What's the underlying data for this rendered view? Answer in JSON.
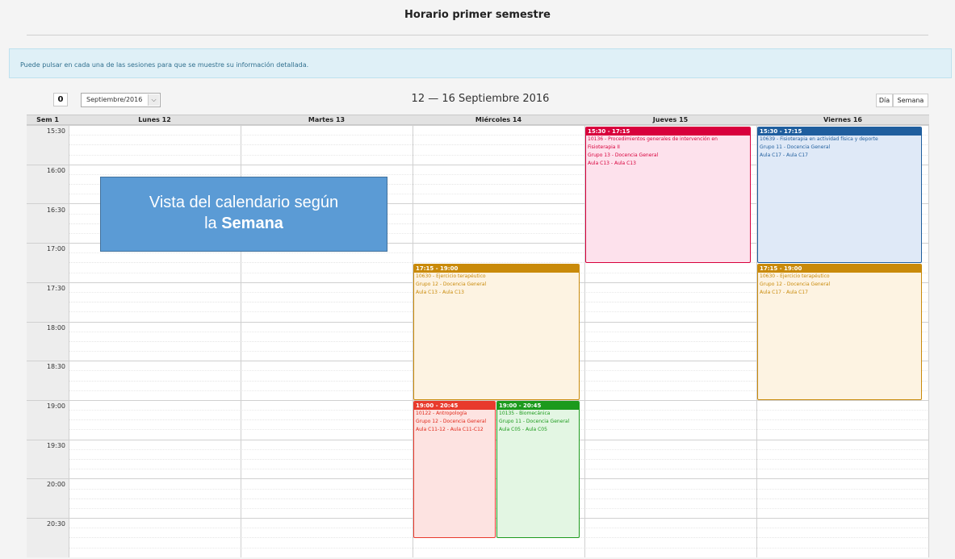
{
  "page": {
    "title": "Horario primer semestre",
    "info": "Puede pulsar en cada una de las sesiones para que se muestre su información detallada."
  },
  "toolbar": {
    "today_label": "0",
    "month_select": "Septiembre/2016",
    "date_range": "12 — 16 Septiembre 2016",
    "view_day": "Día",
    "view_week": "Semana"
  },
  "calendar": {
    "week_label": "Sem 1",
    "days": [
      {
        "label": "Lunes 12"
      },
      {
        "label": "Martes 13"
      },
      {
        "label": "Miércoles 14"
      },
      {
        "label": "Jueves 15"
      },
      {
        "label": "Viernes 16"
      }
    ],
    "time_labels": [
      "15:30",
      "16:00",
      "16:30",
      "17:00",
      "17:30",
      "18:00",
      "18:30",
      "19:00",
      "19:30",
      "20:00",
      "20:30"
    ],
    "events": [
      {
        "time": "15:30 - 17:15",
        "line1": "10136 - Procedimientos generales de intervención en",
        "line2": "Fisioterapia II",
        "line3": "Grupo 13 - Docencia General",
        "line4": "Aula C13 - Aula C13",
        "head_color": "#d8003c",
        "bg_color": "#fde1ec",
        "text_color": "#d8003c"
      },
      {
        "time": "15:30 - 17:15",
        "line1": "10639 - Fisioterapia en actividad física y deporte",
        "line2": "Grupo 11 - Docencia General",
        "line3": "Aula C17 - Aula C17",
        "head_color": "#1f5e9e",
        "bg_color": "#dfe9f7",
        "text_color": "#1f5e9e"
      },
      {
        "time": "17:15 - 19:00",
        "line1": "10630 - Ejercicio terapéutico",
        "line2": "Grupo 12 - Docencia General",
        "line3": "Aula C13 - Aula C13",
        "head_color": "#c98a0a",
        "bg_color": "#fdf3e2",
        "text_color": "#c98a0a"
      },
      {
        "time": "17:15 - 19:00",
        "line1": "10630 - Ejercicio terapéutico",
        "line2": "Grupo 12 - Docencia General",
        "line3": "Aula C17 - Aula C17",
        "head_color": "#c98a0a",
        "bg_color": "#fdf3e2",
        "text_color": "#c98a0a"
      },
      {
        "time": "19:00 - 20:45",
        "line1": "10122 - Antropología",
        "line2": "Grupo 12 - Docencia General",
        "line3": "Aula C11-12 - Aula C11-C12",
        "head_color": "#e83a2c",
        "bg_color": "#fde3e1",
        "text_color": "#e0281a"
      },
      {
        "time": "19:00 - 20:45",
        "line1": "10135 - Biomecánica",
        "line2": "Grupo 11 - Docencia General",
        "line3": "Aula C05 - Aula C05",
        "head_color": "#1c9a1c",
        "bg_color": "#e3f6e3",
        "text_color": "#1c9a1c"
      }
    ]
  },
  "overlay": {
    "line1": "Vista del calendario según",
    "prefix": "la",
    "bold": "Semana"
  }
}
